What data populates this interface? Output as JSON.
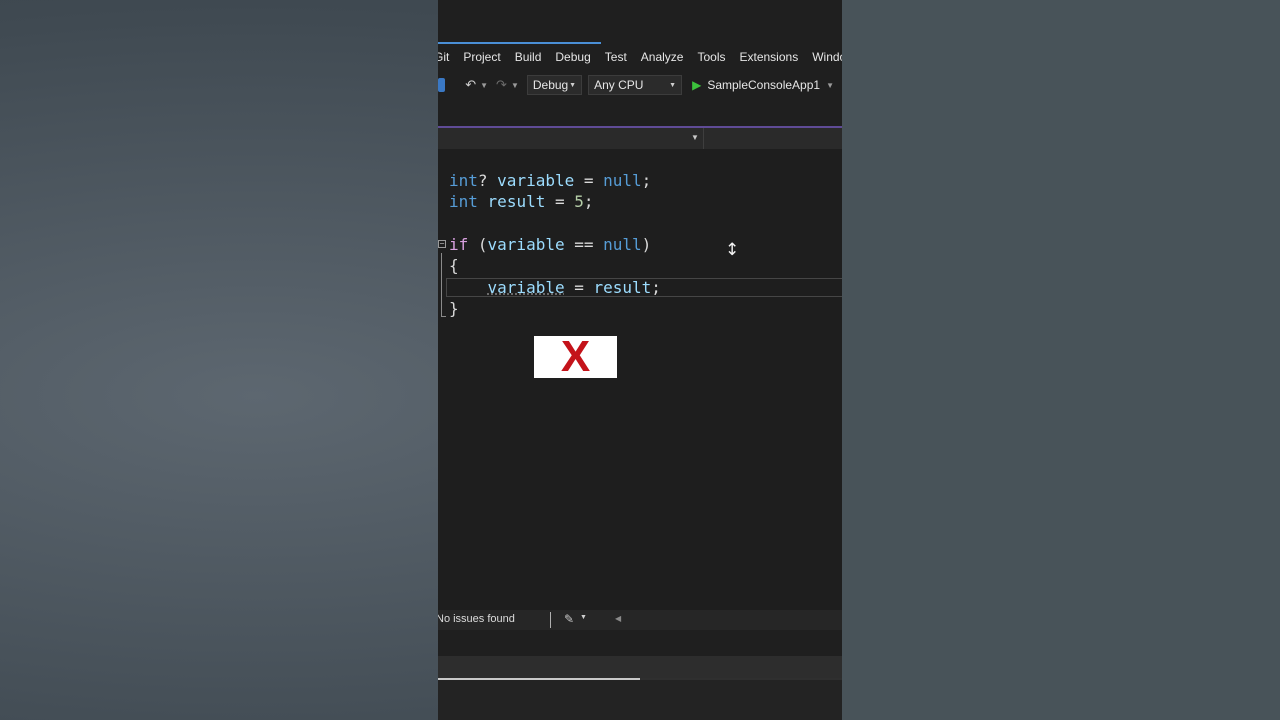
{
  "menu": {
    "items": [
      "Git",
      "Project",
      "Build",
      "Debug",
      "Test",
      "Analyze",
      "Tools",
      "Extensions",
      "Window"
    ]
  },
  "toolbar": {
    "configuration": "Debug",
    "platform": "Any CPU",
    "startup_project": "SampleConsoleApp1",
    "icons": [
      "solution-icon",
      "undo-icon",
      "redo-icon",
      "run-icon"
    ]
  },
  "editor": {
    "lines": [
      "int? variable = null;",
      "int result = 5;",
      "",
      "if (variable == null)",
      "{",
      "    variable = result;",
      "}"
    ]
  },
  "overlay": {
    "mark": "X",
    "colors": {
      "mark": "#c4131a",
      "background": "#ffffff"
    }
  },
  "status": {
    "issues": "No issues found",
    "icons": [
      "broom-icon"
    ]
  },
  "progress": {
    "value": 0.5
  },
  "colors": {
    "editor_bg": "#1e1e1e",
    "keyword": "#569cd6",
    "control_keyword": "#d8a0df",
    "number": "#b5cea8",
    "variable": "#9cdcfe",
    "accent": "#4a8fd6",
    "run": "#3cc23c"
  }
}
